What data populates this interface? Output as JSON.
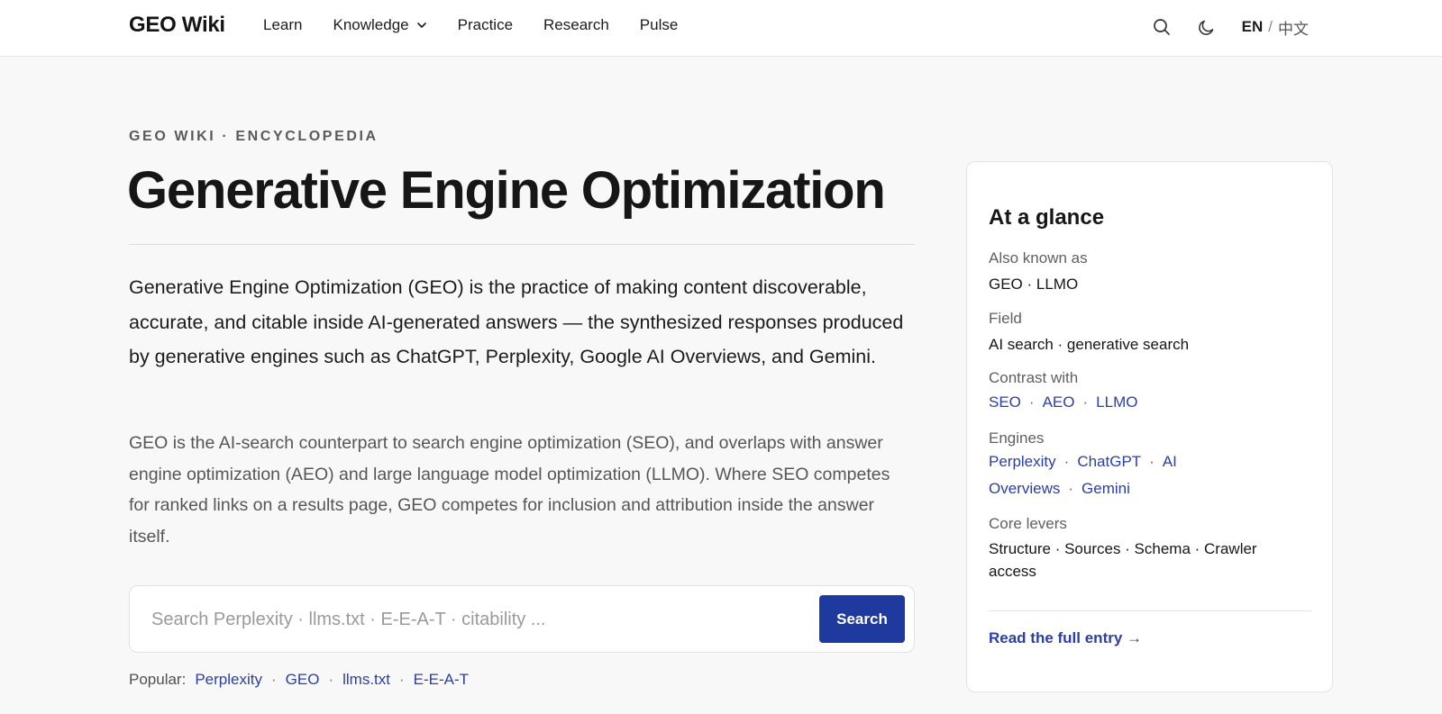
{
  "header": {
    "brand": "GEO Wiki",
    "nav": [
      {
        "label": "Learn"
      },
      {
        "label": "Knowledge",
        "has_dropdown": true
      },
      {
        "label": "Practice"
      },
      {
        "label": "Research"
      },
      {
        "label": "Pulse"
      }
    ],
    "icons": {
      "search": "search-icon",
      "theme": "moon-icon"
    },
    "lang": {
      "en": "EN",
      "separator": "/",
      "zh": "中文"
    }
  },
  "main": {
    "kicker": "GEO WIKI · ENCYCLOPEDIA",
    "title": "Generative Engine Optimization",
    "lead": "Generative Engine Optimization (GEO) is the practice of making content discoverable, accurate, and citable inside AI-generated answers — the synthesized responses produced by generative engines such as ChatGPT, Perplexity, Google AI Overviews, and Gemini.",
    "body": "GEO is the AI-search counterpart to search engine optimization (SEO), and overlaps with answer engine optimization (AEO) and large language model optimization (LLMO). Where SEO competes for ranked links on a results page, GEO competes for inclusion and attribution inside the answer itself.",
    "search": {
      "placeholder": "Search Perplexity · llms.txt · E-E-A-T · citability ...",
      "value": "",
      "button": "Search"
    },
    "popular": {
      "label": "Popular:",
      "links": [
        "Perplexity",
        "GEO",
        "llms.txt",
        "E-E-A-T"
      ]
    }
  },
  "glance": {
    "title": "At a glance",
    "aka_label": "Also known as",
    "aka_value": "GEO · LLMO",
    "field_label": "Field",
    "field_value": "AI search · generative search",
    "contrast_label": "Contrast with",
    "contrast_links": [
      "SEO",
      "AEO",
      "LLMO"
    ],
    "engines_label": "Engines",
    "engines_links": [
      "Perplexity",
      "ChatGPT",
      "AI Overviews",
      "Gemini"
    ],
    "levers_label": "Core levers",
    "levers_value": "Structure · Sources · Schema · Crawler access",
    "cta": "Read the full entry →"
  },
  "colors": {
    "accent": "#1f3a9e",
    "link": "#2a3fa8",
    "background": "#f8f8f8",
    "card": "#ffffff"
  }
}
